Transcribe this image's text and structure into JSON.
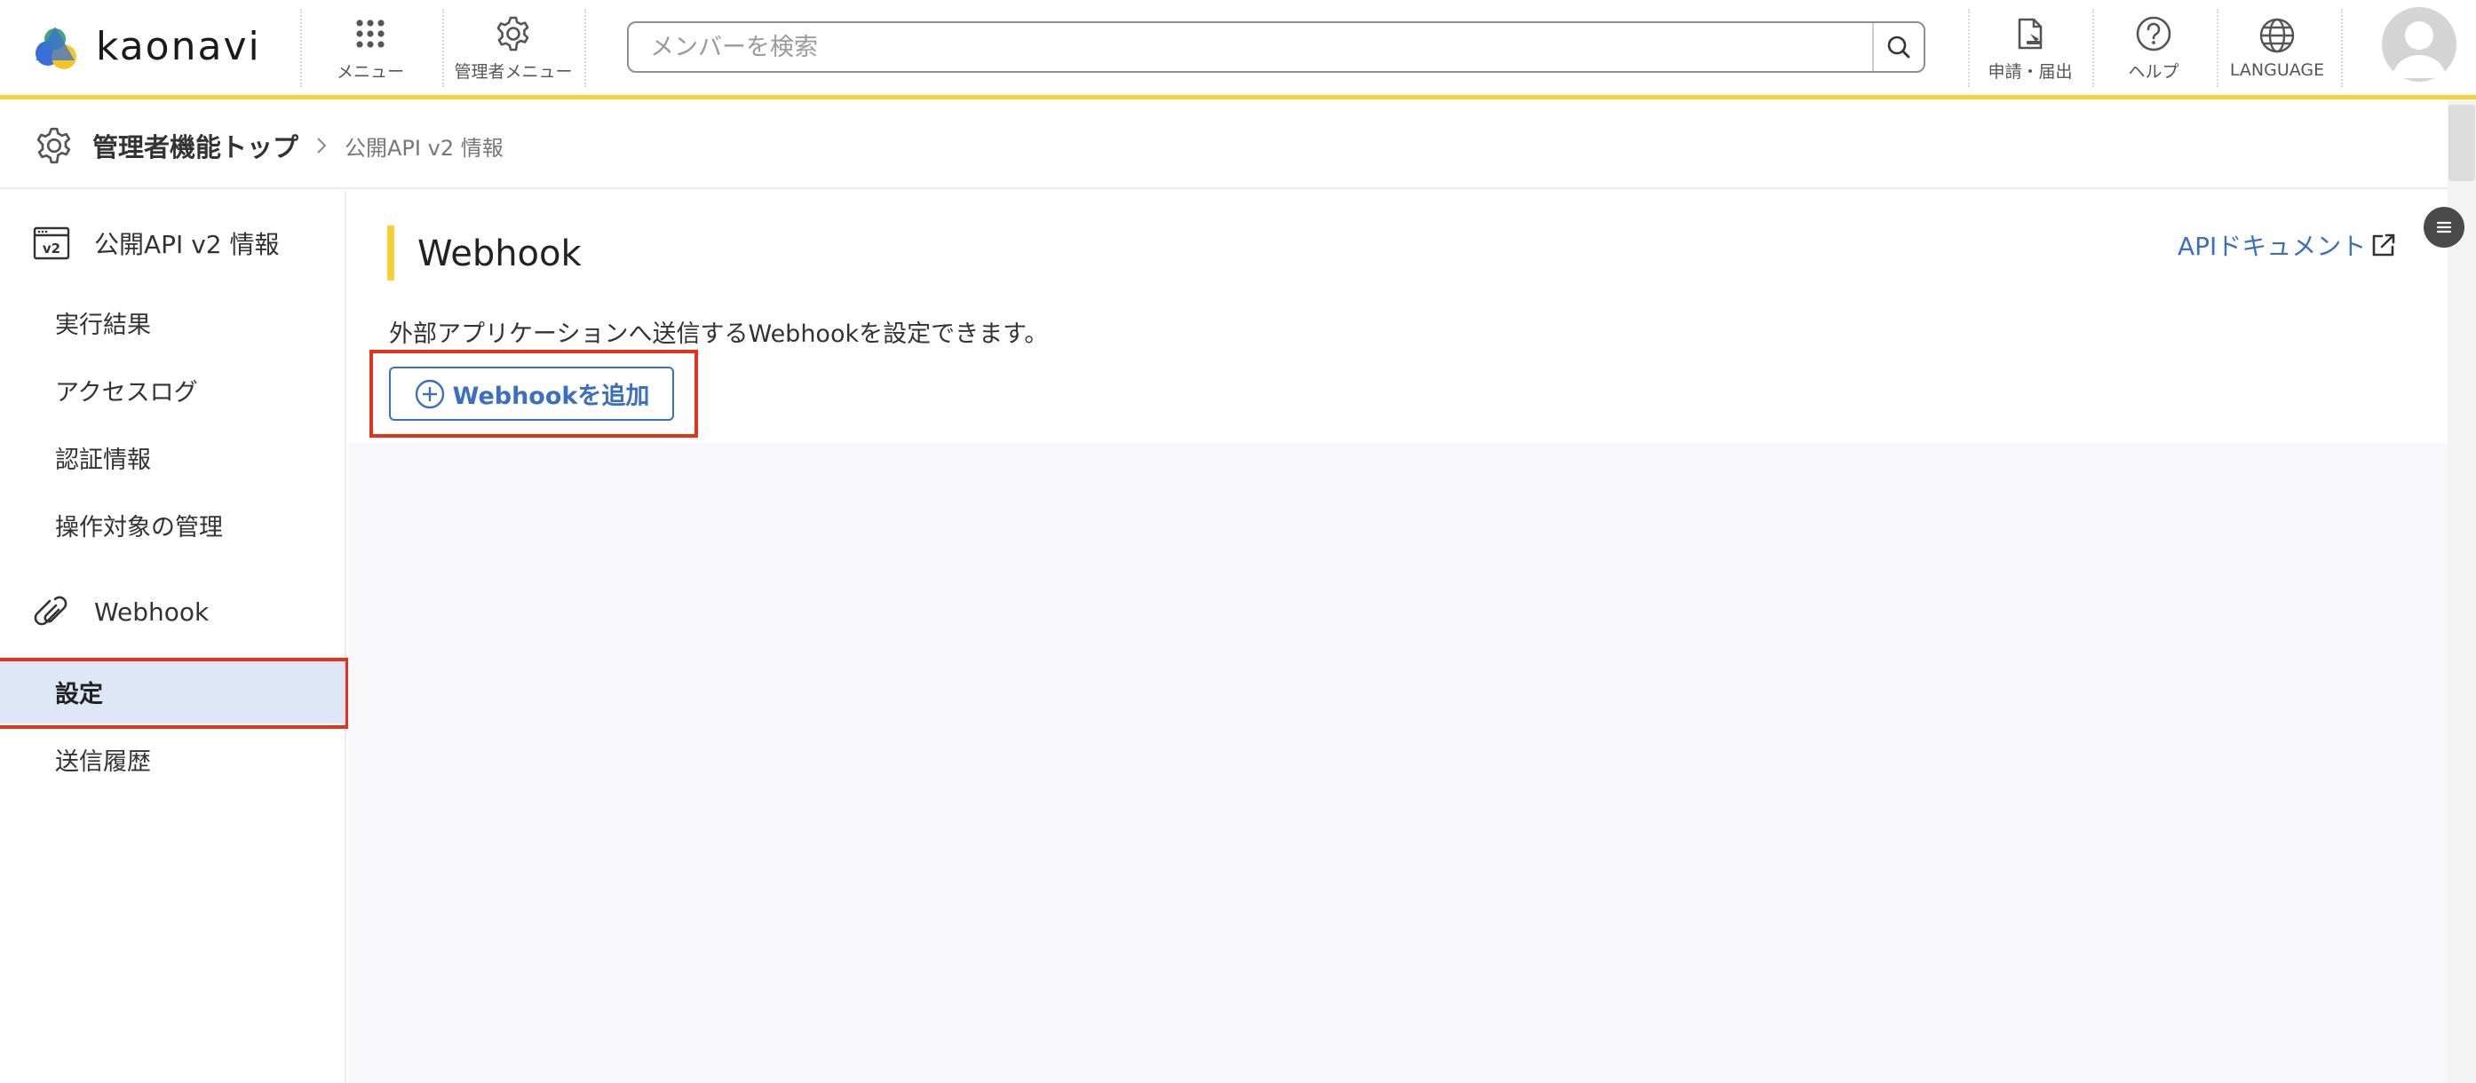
{
  "header": {
    "logo_text": "kaonavi",
    "menu_label": "メニュー",
    "admin_menu_label": "管理者メニュー",
    "search_placeholder": "メンバーを検索",
    "request_label": "申請・届出",
    "help_label": "ヘルプ",
    "language_label": "LANGUAGE"
  },
  "breadcrumb": {
    "top": "管理者機能トップ",
    "current": "公開API v2 情報"
  },
  "sidebar": {
    "section1_title": "公開API v2 情報",
    "section1_items": [
      "実行結果",
      "アクセスログ",
      "認証情報",
      "操作対象の管理"
    ],
    "section2_title": "Webhook",
    "section2_items": [
      "設定",
      "送信履歴"
    ],
    "active_item": "設定"
  },
  "main": {
    "title": "Webhook",
    "api_doc_link": "APIドキュメント",
    "description": "外部アプリケーションへ送信するWebhookを設定できます。",
    "add_button": "Webhookを追加"
  },
  "colors": {
    "accent_yellow": "#f6d23a",
    "link_blue": "#3a6fc4",
    "active_bg": "#dfe7f6",
    "highlight_red": "#e4321b"
  }
}
